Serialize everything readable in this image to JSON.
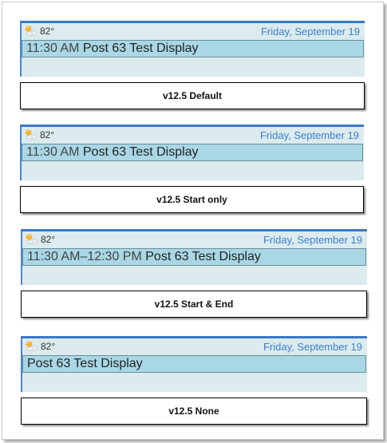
{
  "panels": [
    {
      "temp": "82°",
      "date": "Friday, September 19",
      "time": "11:30 AM",
      "title": "Post 63 Test Display",
      "caption": "v12.5 Default"
    },
    {
      "temp": "82°",
      "date": "Friday, September 19",
      "time": "11:30 AM",
      "title": "Post 63 Test Display",
      "caption": "v12.5 Start only"
    },
    {
      "temp": "82°",
      "date": "Friday, September 19",
      "time": "11:30 AM–12:30 PM",
      "title": "Post 63 Test Display",
      "caption": "v12.5 Start & End"
    },
    {
      "temp": "82°",
      "date": "Friday, September 19",
      "time": "",
      "title": "Post 63 Test Display",
      "caption": "v12.5 None"
    }
  ],
  "colors": {
    "accent": "#3a78c6",
    "widget_bg": "#dcebed",
    "event_bar": "#a9d7e6",
    "date_text": "#3b7fd0"
  },
  "icons": {
    "weather": "partly-sunny-icon"
  }
}
